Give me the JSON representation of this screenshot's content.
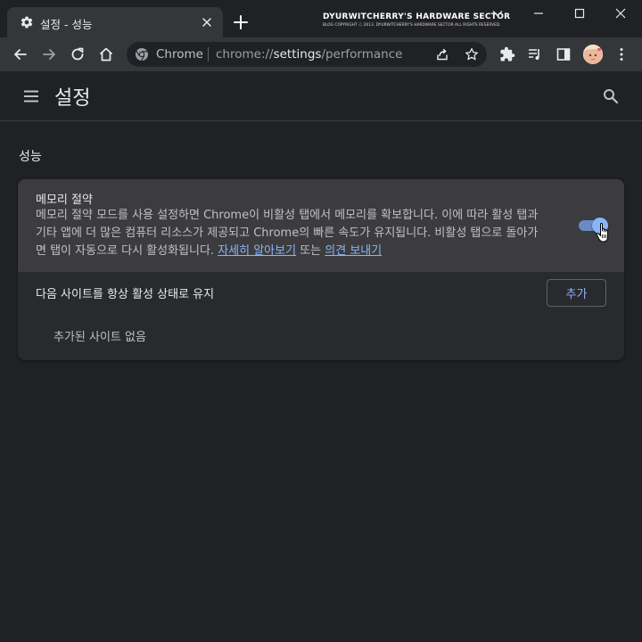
{
  "tab": {
    "title": "설정 - 성능",
    "favicon": "gear-icon"
  },
  "watermark": {
    "line1": "DYURWITCHERRY'S HARDWARE SECTOR",
    "line2": "BLOG COPYRIGHT ⓒ 2013. DYURWITCHERRY'S HARDWARE SECTOR ALL RIGHTS RESERVED."
  },
  "omnibox": {
    "chip": "Chrome",
    "url_scheme": "chrome://",
    "url_host": "settings",
    "url_path": "/performance"
  },
  "header": {
    "title": "설정"
  },
  "section": {
    "title": "성능"
  },
  "memory_saver": {
    "title": "메모리 절약",
    "desc_lines": [
      "메모리 절약 모드를 사용 설정하면 Chrome이 비활성 탭에서 메모리를 확보합니다. 이에 따라 활성 탭과",
      "기타 앱에 더 많은 컴퓨터 리소스가 제공되고 Chrome의 빠른 속도가 유지됩니다. 비활성 탭으로 돌아가",
      "면 탭이 자동으로 다시 활성화됩니다."
    ],
    "learn_more": "자세히 알아보기",
    "or_text": "또는",
    "feedback": "의견 보내기",
    "enabled": true
  },
  "keep_active": {
    "title": "다음 사이트를 항상 활성 상태로 유지",
    "add_label": "추가",
    "empty_text": "추가된 사이트 없음"
  },
  "colors": {
    "background": "#202124",
    "toolbar": "#35363a",
    "card": "#292a2d",
    "card_top": "#3c3c3f",
    "accent": "#8ab4f8"
  }
}
